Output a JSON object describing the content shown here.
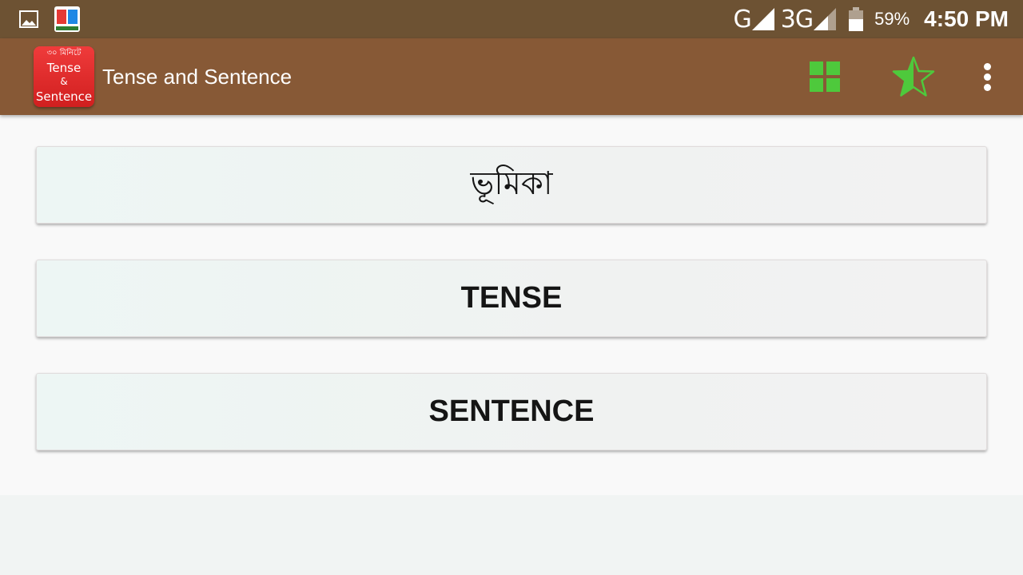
{
  "status_bar": {
    "left_icons": [
      "image-notification-icon",
      "app-notification-icon"
    ],
    "network_1": "G",
    "network_2": "3G",
    "battery_percent": "59%",
    "battery_level": 0.59,
    "time": "4:50 PM"
  },
  "app_bar": {
    "logo": {
      "top": "৩০ মিনিটে",
      "line1": "Tense",
      "line2": "&",
      "line3": "Sentence"
    },
    "title": "Tense and Sentence",
    "actions": [
      "grid-icon",
      "star-half-icon",
      "more-vert-icon"
    ]
  },
  "colors": {
    "status_bar": "#6d5233",
    "app_bar": "#875936",
    "action_green": "#4ec93c",
    "logo_red": "#e52b2b"
  },
  "menu": [
    {
      "label": "ভূমিকা"
    },
    {
      "label": "TENSE"
    },
    {
      "label": "SENTENCE"
    }
  ]
}
